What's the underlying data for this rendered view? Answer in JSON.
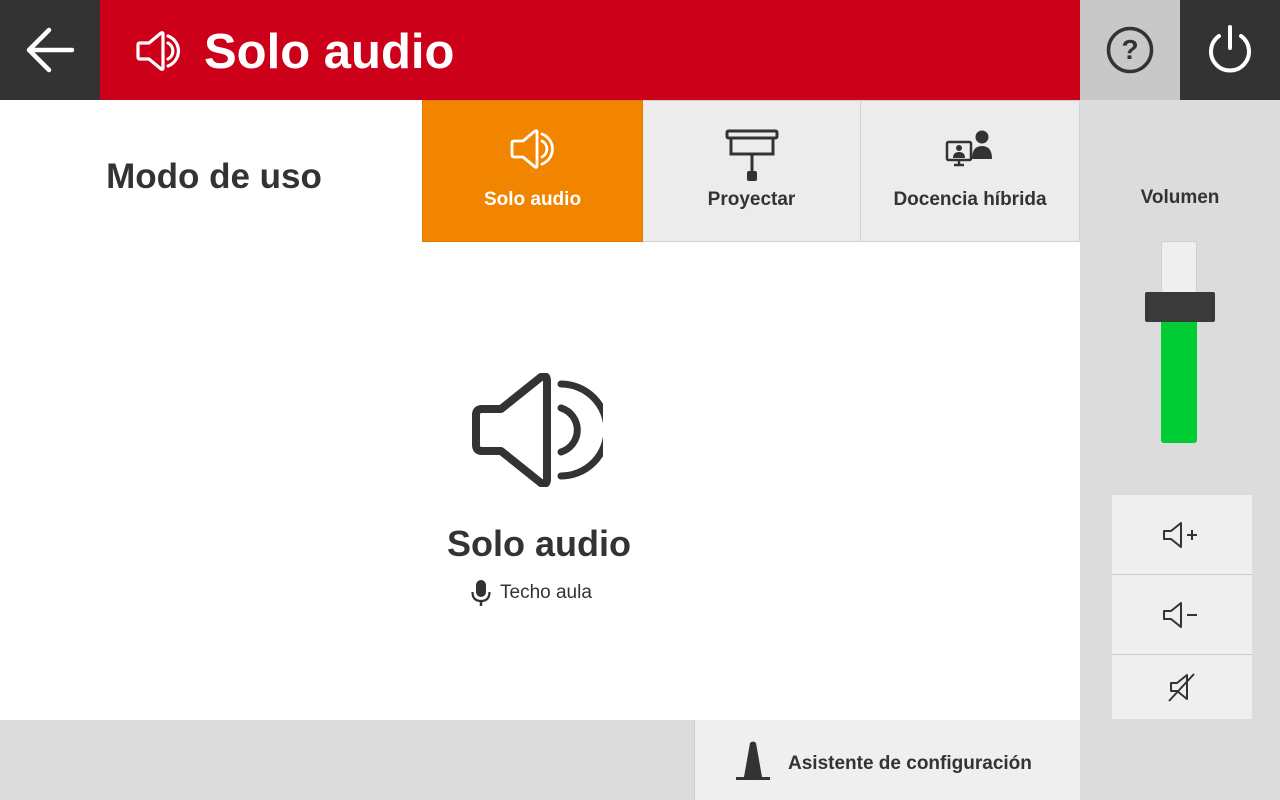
{
  "header": {
    "title": "Solo audio",
    "accent_color": "#cc0018",
    "icons": {
      "back": "arrow-left-icon",
      "title": "speaker-icon",
      "help": "help-icon",
      "power": "power-icon"
    }
  },
  "mode_section": {
    "label": "Modo de uso"
  },
  "tabs": [
    {
      "label": "Solo audio",
      "icon": "speaker-icon",
      "active": true,
      "color": "#f28500"
    },
    {
      "label": "Proyectar",
      "icon": "projector-screen-icon",
      "active": false
    },
    {
      "label": "Docencia híbrida",
      "icon": "hybrid-teaching-icon",
      "active": false
    }
  ],
  "content": {
    "icon": "speaker-icon",
    "title": "Solo audio",
    "mic_label": "Techo aula",
    "mic_icon": "microphone-icon"
  },
  "footer": {
    "wizard_label": "Asistente de configuración",
    "wizard_icon": "cone-icon"
  },
  "volume": {
    "label": "Volumen",
    "level": 0.6,
    "fill_color": "#00cc33",
    "buttons": [
      {
        "name": "volume-up",
        "icon": "speaker-plus-icon"
      },
      {
        "name": "volume-down",
        "icon": "speaker-minus-icon"
      },
      {
        "name": "mute",
        "icon": "speaker-muted-icon"
      }
    ]
  }
}
